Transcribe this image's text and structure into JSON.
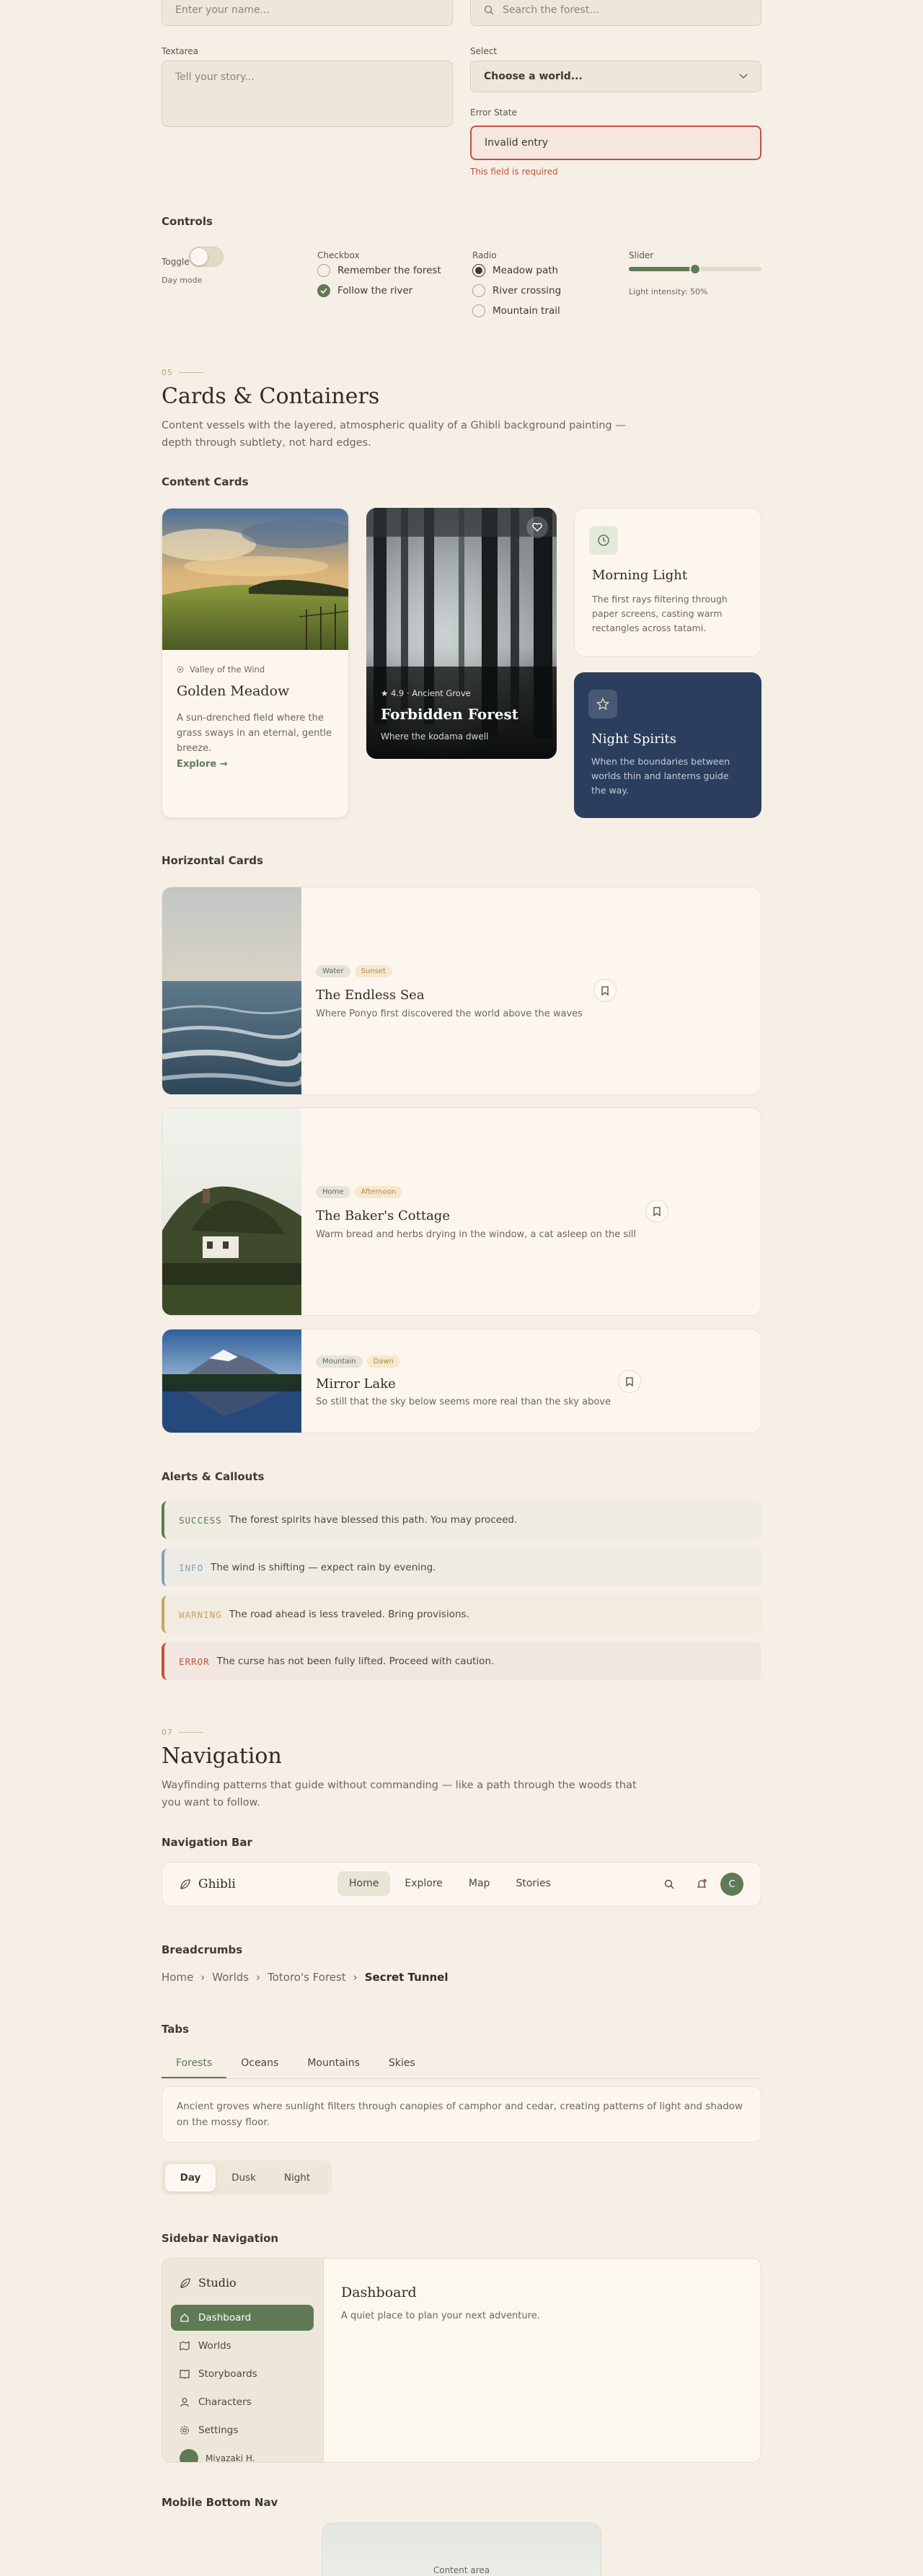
{
  "form": {
    "name_placeholder": "Enter your name...",
    "search_placeholder": "Search the forest...",
    "textarea_label": "Textarea",
    "textarea_placeholder": "Tell your story...",
    "select_label": "Select",
    "select_value": "Choose a world...",
    "error_label": "Error State",
    "error_value": "Invalid entry",
    "error_message": "This field is required"
  },
  "controls": {
    "title": "Controls",
    "toggle_label": "Toggle",
    "toggle_caption": "Day mode",
    "checkbox_label": "Checkbox",
    "checkboxes": [
      {
        "label": "Remember the forest",
        "checked": false
      },
      {
        "label": "Follow the river",
        "checked": true
      }
    ],
    "radio_label": "Radio",
    "radios": [
      {
        "label": "Meadow path",
        "checked": true
      },
      {
        "label": "River crossing",
        "checked": false
      },
      {
        "label": "Mountain trail",
        "checked": false
      }
    ],
    "slider_label": "Slider",
    "slider_caption": "Light intensity: 50%",
    "slider_value": 0.5
  },
  "cards_section": {
    "number": "05",
    "title": "Cards & Containers",
    "description": "Content vessels with the layered, atmospheric quality of a Ghibli background painting — depth through subtlety, not hard edges.",
    "content_cards_title": "Content Cards",
    "meadow": {
      "location": "Valley of the Wind",
      "title": "Golden Meadow",
      "text": "A sun-drenched field where the grass sways in an eternal, gentle breeze.",
      "link": "Explore →"
    },
    "forest": {
      "meta": "★ 4.9 · Ancient Grove",
      "title": "Forbidden Forest",
      "subtitle": "Where the kodama dwell"
    },
    "morning": {
      "title": "Morning Light",
      "text": "The first rays filtering through paper screens, casting warm rectangles across tatami."
    },
    "night": {
      "title": "Night Spirits",
      "text": "When the boundaries between worlds thin and lanterns guide the way."
    },
    "horizontal_title": "Horizontal Cards",
    "horizontal": [
      {
        "tag1": "Water",
        "tag2": "Sunset",
        "title": "The Endless Sea",
        "text": "Where Ponyo first discovered the world above the waves"
      },
      {
        "tag1": "Home",
        "tag2": "Afternoon",
        "title": "The Baker's Cottage",
        "text": "Warm bread and herbs drying in the window, a cat asleep on the sill"
      },
      {
        "tag1": "Mountain",
        "tag2": "Dawn",
        "title": "Mirror Lake",
        "text": "So still that the sky below seems more real than the sky above"
      }
    ],
    "alerts_title": "Alerts & Callouts",
    "alerts": [
      {
        "code": "SUCCESS",
        "text": "The forest spirits have blessed this path. You may proceed."
      },
      {
        "code": "INFO",
        "text": "The wind is shifting — expect rain by evening."
      },
      {
        "code": "WARNING",
        "text": "The road ahead is less traveled. Bring provisions."
      },
      {
        "code": "ERROR",
        "text": "The curse has not been fully lifted. Proceed with caution."
      }
    ]
  },
  "nav_section": {
    "number": "07",
    "title": "Navigation",
    "description": "Wayfinding patterns that guide without commanding — like a path through the woods that you want to follow.",
    "navbar_title": "Navigation Bar",
    "brand": "Ghibli",
    "links": [
      "Home",
      "Explore",
      "Map",
      "Stories"
    ],
    "avatar_initial": "C",
    "breadcrumbs_title": "Breadcrumbs",
    "breadcrumbs": [
      "Home",
      "Worlds",
      "Totoro's Forest",
      "Secret Tunnel"
    ],
    "tabs_title": "Tabs",
    "tabs": [
      "Forests",
      "Oceans",
      "Mountains",
      "Skies"
    ],
    "tab_content": "Ancient groves where sunlight filters through canopies of camphor and cedar, creating patterns of light and shadow on the mossy floor.",
    "segments": [
      "Day",
      "Dusk",
      "Night"
    ],
    "sidebar_title": "Sidebar Navigation",
    "sidebar_brand": "Studio",
    "sidebar_items": [
      "Dashboard",
      "Worlds",
      "Storyboards",
      "Characters",
      "Settings"
    ],
    "sidebar_user": "Miyazaki H.",
    "dashboard_title": "Dashboard",
    "dashboard_text": "A quiet place to plan your next adventure.",
    "mobile_title": "Mobile Bottom Nav",
    "mobile_content": "Content area"
  },
  "colors": {
    "accent_green": "#5f7a55",
    "navy": "#2c3e5e",
    "error": "#c0533e",
    "info": "#7fa3bd",
    "warning": "#c9a45c"
  }
}
